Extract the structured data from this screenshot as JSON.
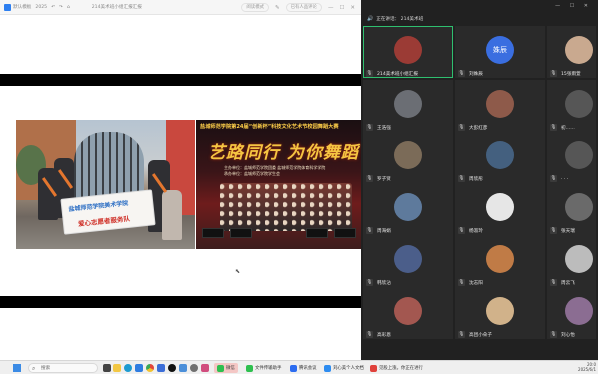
{
  "document": {
    "titlebar": {
      "app_label": "默认模板",
      "doc_label": "2025",
      "tab_title": "214美术班小组汇报汇报",
      "mode_label": "阅读模式",
      "comments_label": "已有人品评论"
    },
    "photo1": {
      "banner_line1": "盐城师范学院美术学院",
      "banner_line2": "爱心志愿者服务队"
    },
    "photo2": {
      "stage_top": "盐城师范学院第24届“创新杯”科技文化艺术节校园舞蹈大赛",
      "slogan": "艺路同行 为你舞蹈",
      "host_line": "主办单位：盐城师范学院团委  盐城师范学院体育科学学院",
      "organizer_line": "承办单位：盐城师范学院学生会"
    }
  },
  "meeting": {
    "status_text": "正在讲话： 214美术班",
    "tiles": [
      {
        "name": "214美术班小组汇报",
        "active": true,
        "avatar": "figure"
      },
      {
        "name": "刘姝辰",
        "avatar_text": "姝辰"
      },
      {
        "name": "15张雨萱"
      },
      {
        "name": "王浩强"
      },
      {
        "name": "大彭红彦"
      },
      {
        "name": "初……"
      },
      {
        "name": "罗子贤"
      },
      {
        "name": "周欣彤"
      },
      {
        "name": "· · ·"
      },
      {
        "name": "周海娟"
      },
      {
        "name": "杨淑玲"
      },
      {
        "name": "张天瑞"
      },
      {
        "name": "韩欣沾"
      },
      {
        "name": "沈志阳"
      },
      {
        "name": "周云飞"
      },
      {
        "name": "高彩恩"
      },
      {
        "name": "高团小朵子"
      },
      {
        "name": "刘心怡"
      }
    ]
  },
  "taskbar": {
    "search_placeholder": "搜索",
    "apps": [
      {
        "name": "wechat",
        "label": "微信"
      },
      {
        "name": "file-transfer",
        "label": "文件传输助手"
      },
      {
        "name": "tencent-meeting",
        "label": "腾讯会议"
      },
      {
        "name": "wps",
        "label": "刘心美个人文档"
      },
      {
        "name": "watermark",
        "label": "见股上涨。你正在进行"
      }
    ],
    "tray_time": "20:0",
    "tray_date": "2025/6/1"
  }
}
